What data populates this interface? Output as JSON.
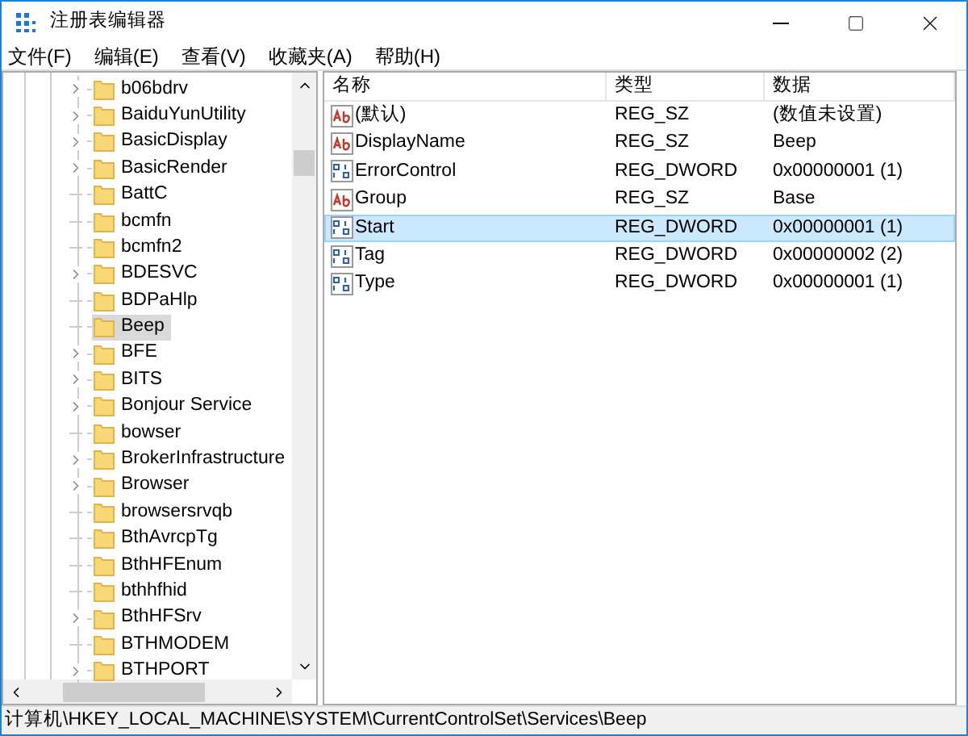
{
  "window": {
    "title": "注册表编辑器"
  },
  "menu": [
    "文件(F)",
    "编辑(E)",
    "查看(V)",
    "收藏夹(A)",
    "帮助(H)"
  ],
  "tree": [
    {
      "label": "b06bdrv",
      "expandable": true,
      "selected": false
    },
    {
      "label": "BaiduYunUtility",
      "expandable": true,
      "selected": false
    },
    {
      "label": "BasicDisplay",
      "expandable": true,
      "selected": false
    },
    {
      "label": "BasicRender",
      "expandable": true,
      "selected": false
    },
    {
      "label": "BattC",
      "expandable": false,
      "selected": false
    },
    {
      "label": "bcmfn",
      "expandable": false,
      "selected": false
    },
    {
      "label": "bcmfn2",
      "expandable": false,
      "selected": false
    },
    {
      "label": "BDESVC",
      "expandable": true,
      "selected": false
    },
    {
      "label": "BDPaHlp",
      "expandable": false,
      "selected": false
    },
    {
      "label": "Beep",
      "expandable": false,
      "selected": true
    },
    {
      "label": "BFE",
      "expandable": true,
      "selected": false
    },
    {
      "label": "BITS",
      "expandable": true,
      "selected": false
    },
    {
      "label": "Bonjour Service",
      "expandable": true,
      "selected": false
    },
    {
      "label": "bowser",
      "expandable": false,
      "selected": false
    },
    {
      "label": "BrokerInfrastructure",
      "expandable": true,
      "selected": false
    },
    {
      "label": "Browser",
      "expandable": true,
      "selected": false
    },
    {
      "label": "browsersrvqb",
      "expandable": false,
      "selected": false
    },
    {
      "label": "BthAvrcpTg",
      "expandable": false,
      "selected": false
    },
    {
      "label": "BthHFEnum",
      "expandable": false,
      "selected": false
    },
    {
      "label": "bthhfhid",
      "expandable": false,
      "selected": false
    },
    {
      "label": "BthHFSrv",
      "expandable": true,
      "selected": false
    },
    {
      "label": "BTHMODEM",
      "expandable": false,
      "selected": false
    },
    {
      "label": "BTHPORT",
      "expandable": true,
      "selected": false
    }
  ],
  "table": {
    "columns": [
      "名称",
      "类型",
      "数据"
    ],
    "rows": [
      {
        "kind": "string",
        "name": "(默认)",
        "type": "REG_SZ",
        "data": "(数值未设置)",
        "selected": false
      },
      {
        "kind": "string",
        "name": "DisplayName",
        "type": "REG_SZ",
        "data": "Beep",
        "selected": false
      },
      {
        "kind": "binary",
        "name": "ErrorControl",
        "type": "REG_DWORD",
        "data": "0x00000001 (1)",
        "selected": false
      },
      {
        "kind": "string",
        "name": "Group",
        "type": "REG_SZ",
        "data": "Base",
        "selected": false
      },
      {
        "kind": "binary",
        "name": "Start",
        "type": "REG_DWORD",
        "data": "0x00000001 (1)",
        "selected": true
      },
      {
        "kind": "binary",
        "name": "Tag",
        "type": "REG_DWORD",
        "data": "0x00000002 (2)",
        "selected": false
      },
      {
        "kind": "binary",
        "name": "Type",
        "type": "REG_DWORD",
        "data": "0x00000001 (1)",
        "selected": false
      }
    ]
  },
  "status_bar": "计算机\\HKEY_LOCAL_MACHINE\\SYSTEM\\CurrentControlSet\\Services\\Beep"
}
